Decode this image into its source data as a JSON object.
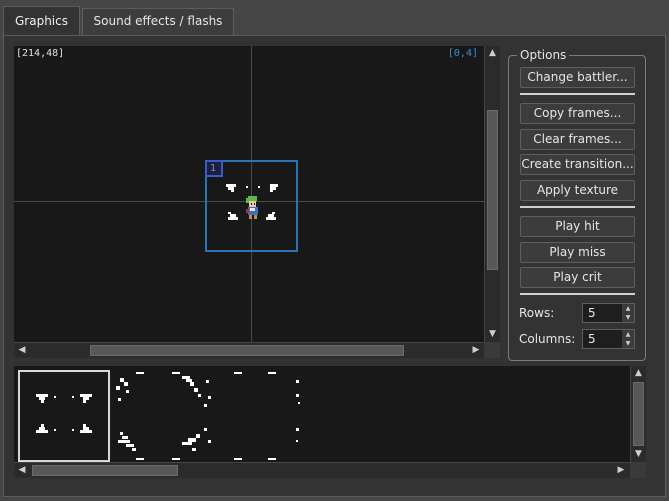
{
  "tabs": [
    {
      "label": "Graphics",
      "active": true
    },
    {
      "label": "Sound effects / flashs",
      "active": false
    }
  ],
  "canvas": {
    "cursor_coord": "[214,48]",
    "cell_coord": "[0,4]",
    "frame_number": "1",
    "colors": {
      "frame_border": "#2a73b8",
      "badge_border": "#3b5bd0",
      "cell_coord_text": "#3a8ed8",
      "background": "#181818"
    }
  },
  "options": {
    "title": "Options",
    "buttons": {
      "change_battler": "Change battler...",
      "copy_frames": "Copy frames...",
      "clear_frames": "Clear frames...",
      "create_transition": "Create transition...",
      "apply_texture": "Apply texture",
      "play_hit": "Play hit",
      "play_miss": "Play miss",
      "play_crit": "Play crit"
    },
    "rows": {
      "label": "Rows:",
      "value": "5"
    },
    "columns": {
      "label": "Columns:",
      "value": "5"
    }
  },
  "frames_strip": {
    "selected_index": 0
  },
  "icons": {
    "arrow_up": "▲",
    "arrow_down": "▼",
    "arrow_left": "◀",
    "arrow_right": "▶"
  }
}
